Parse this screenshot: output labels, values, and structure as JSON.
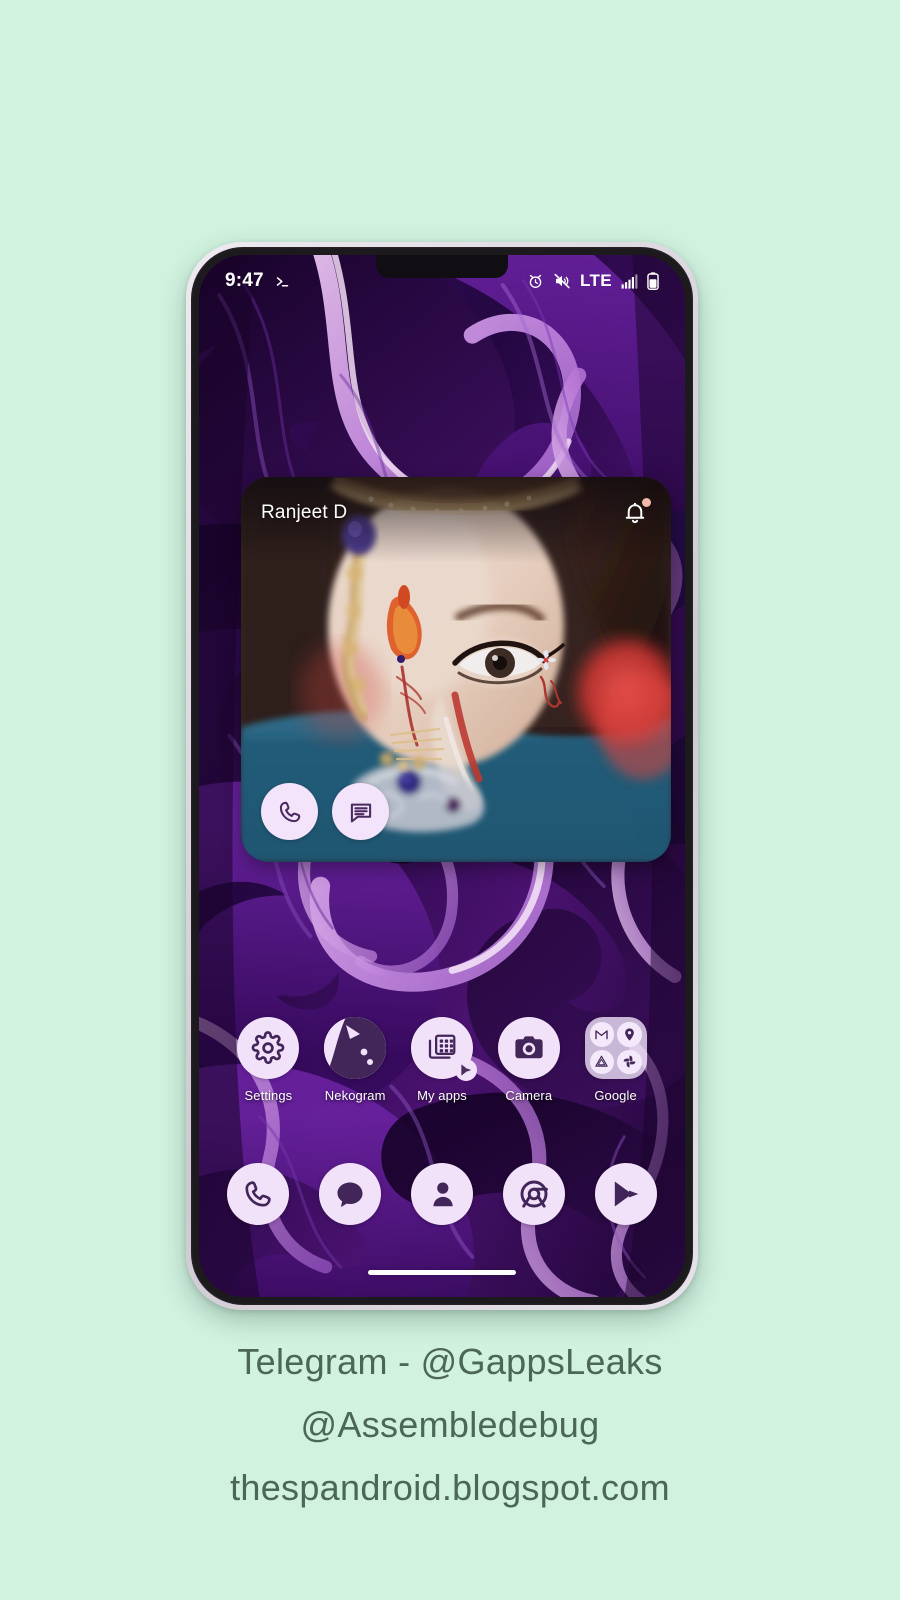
{
  "background_color": "#d0f2df",
  "device": {
    "frame_color": "#e3dde6",
    "bezel_color": "#1c1a1d"
  },
  "status_bar": {
    "time": "9:47",
    "left_icons": [
      "terminal-icon"
    ],
    "right_icons": [
      "alarm-icon",
      "volume-mute-icon",
      "signal-icon",
      "battery-icon"
    ],
    "network_label": "LTE"
  },
  "widget": {
    "type": "contact-widget",
    "contact_name": "Ranjeet D",
    "photo_description": "ganesha-idol-contact-photo",
    "notification_bell": {
      "icon": "bell-icon",
      "has_badge": true,
      "badge_color": "#f2b8ac"
    },
    "actions": [
      {
        "name": "call",
        "icon": "phone-icon"
      },
      {
        "name": "message",
        "icon": "message-icon"
      }
    ],
    "button_bg": "#f4e4fb",
    "button_fg": "#4a2a5e"
  },
  "home_screen": {
    "apps": [
      {
        "label": "Settings",
        "icon": "gear-icon"
      },
      {
        "label": "Nekogram",
        "icon": "cat-icon"
      },
      {
        "label": "My apps",
        "icon": "app-grid-icon",
        "badge": "play-store-badge"
      },
      {
        "label": "Camera",
        "icon": "camera-icon"
      },
      {
        "label": "Google",
        "icon": "folder-icon",
        "folder_apps": [
          "gmail-icon",
          "maps-icon",
          "drive-icon",
          "photos-icon"
        ]
      }
    ],
    "icon_bg": "#f1e2fa",
    "icon_fg": "#4a2a5e",
    "label_color": "#ffffff"
  },
  "dock": {
    "apps": [
      {
        "label": "Phone",
        "icon": "phone-icon"
      },
      {
        "label": "Messages",
        "icon": "message-bubble-icon"
      },
      {
        "label": "Contacts",
        "icon": "person-icon"
      },
      {
        "label": "Chrome",
        "icon": "chrome-icon"
      },
      {
        "label": "Play Store",
        "icon": "play-store-icon"
      }
    ]
  },
  "navigation": {
    "gesture_pill": true
  },
  "caption": {
    "lines": [
      "Telegram - @GappsLeaks",
      "@Assembledebug",
      "thespandroid.blogspot.com"
    ],
    "color": "#4c6658"
  }
}
